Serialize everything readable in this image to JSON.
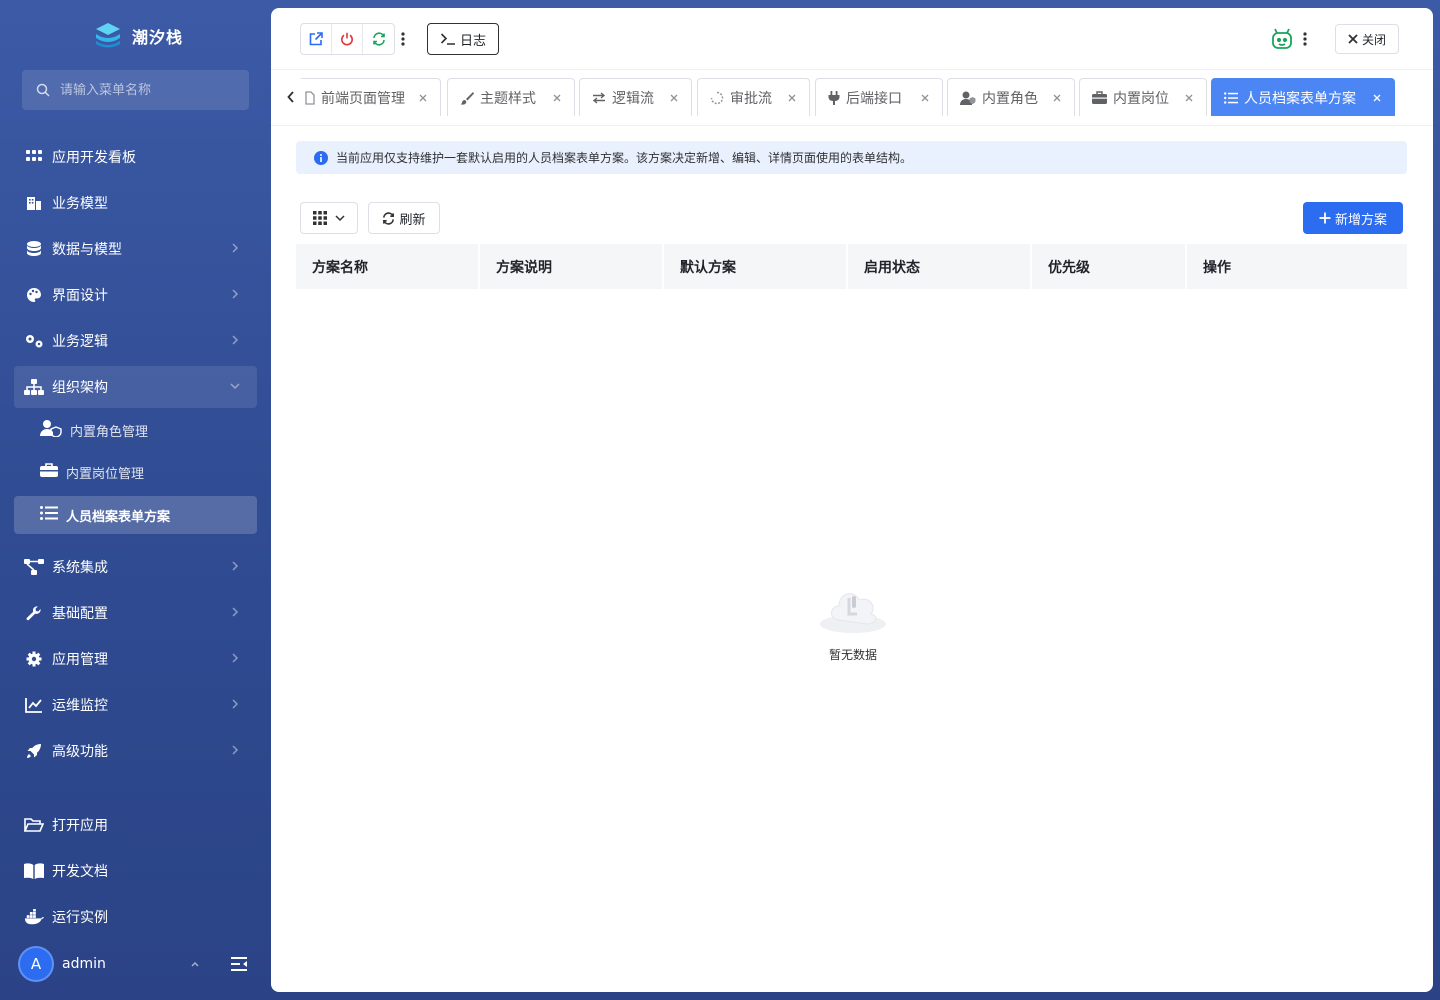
{
  "brand": {
    "name": "潮汐栈"
  },
  "search": {
    "placeholder": "请输入菜单名称"
  },
  "menu": [
    {
      "label": "应用开发看板"
    },
    {
      "label": "业务模型"
    },
    {
      "label": "数据与模型"
    },
    {
      "label": "界面设计"
    },
    {
      "label": "业务逻辑"
    },
    {
      "label": "组织架构"
    }
  ],
  "submenu": [
    {
      "label": "内置角色管理"
    },
    {
      "label": "内置岗位管理"
    },
    {
      "label": "人员档案表单方案"
    }
  ],
  "menu2": [
    {
      "label": "系统集成"
    },
    {
      "label": "基础配置"
    },
    {
      "label": "应用管理"
    },
    {
      "label": "运维监控"
    },
    {
      "label": "高级功能"
    }
  ],
  "menu3": [
    {
      "label": "打开应用"
    },
    {
      "label": "开发文档"
    },
    {
      "label": "运行实例"
    }
  ],
  "user": {
    "avatar_letter": "A",
    "name": "admin"
  },
  "toolbar": {
    "log_label": "日志",
    "close_label": "关闭"
  },
  "tabs": [
    {
      "label": "前端页面管理"
    },
    {
      "label": "主题样式"
    },
    {
      "label": "逻辑流"
    },
    {
      "label": "审批流"
    },
    {
      "label": "后端接口"
    },
    {
      "label": "内置角色"
    },
    {
      "label": "内置岗位"
    },
    {
      "label": "人员档案表单方案"
    }
  ],
  "notice": {
    "text": "当前应用仅支持维护一套默认启用的人员档案表单方案。该方案决定新增、编辑、详情页面使用的表单结构。"
  },
  "actions": {
    "refresh_label": "刷新",
    "add_label": "新增方案"
  },
  "table": {
    "columns": [
      "方案名称",
      "方案说明",
      "默认方案",
      "启用状态",
      "优先级",
      "操作"
    ]
  },
  "empty": {
    "text": "暂无数据"
  },
  "colors": {
    "primary": "#2b6cf0",
    "active_tab": "#4c86f5",
    "notice_bg": "#e9f1fe",
    "sidebar_top": "#3c5aa6"
  }
}
